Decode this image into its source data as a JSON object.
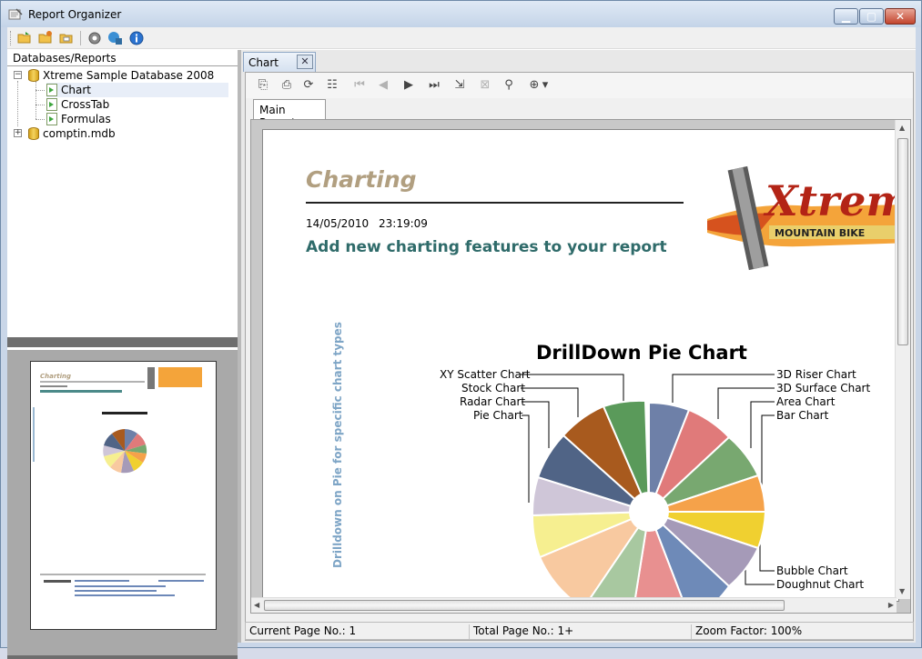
{
  "window": {
    "title": "Report Organizer"
  },
  "left_pane": {
    "header": "Databases/Reports",
    "tree": [
      {
        "label": "Xtreme Sample Database 2008",
        "expand": "−"
      },
      {
        "label": "Chart"
      },
      {
        "label": "CrossTab"
      },
      {
        "label": "Formulas"
      },
      {
        "label": "comptin.mdb",
        "expand": "+"
      }
    ]
  },
  "doc_tab": {
    "label": "Chart",
    "close": "✕"
  },
  "viewer": {
    "tab": "Main Report",
    "status": {
      "current_page": "Current Page No.: 1",
      "total_page": "Total Page No.: 1+",
      "zoom": "Zoom Factor: 100%"
    }
  },
  "report": {
    "title": "Charting",
    "date": "14/05/2010",
    "time": "23:19:09",
    "subtitle": "Add new charting features to your report",
    "vertical_text": "Drilldown on Pie for specific chart types",
    "logo_text": "Xtreme",
    "logo_subtext": "MOUNTAIN BIKE",
    "chart_title": "DrillDown Pie Chart",
    "left_labels": [
      "XY Scatter Chart",
      "Stock Chart",
      "Radar Chart",
      "Pie Chart"
    ],
    "right_labels": [
      "3D Riser Chart",
      "3D Surface Chart",
      "Area Chart",
      "Bar Chart",
      "Bubble Chart",
      "Doughnut Chart"
    ]
  },
  "colors": {
    "title": "#b19f80",
    "subtitle": "#2f6b6a",
    "vertical": "#7ea5c6"
  }
}
